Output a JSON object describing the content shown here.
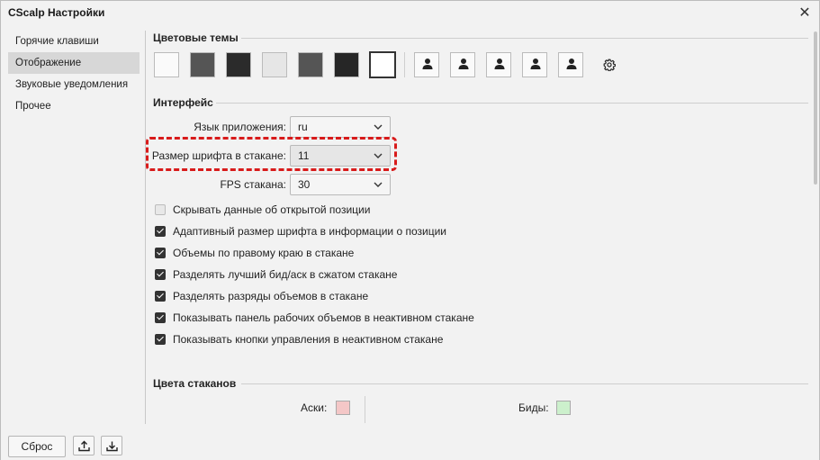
{
  "window": {
    "title": "CScalp Настройки"
  },
  "sidebar": {
    "items": [
      {
        "label": "Горячие клавиши"
      },
      {
        "label": "Отображение"
      },
      {
        "label": "Звуковые уведомления"
      },
      {
        "label": "Прочее"
      }
    ],
    "active_index": 1
  },
  "themes": {
    "title": "Цветовые темы",
    "swatches": [
      "#fafafa",
      "#555555",
      "#2b2b2b",
      "#e6e6e6",
      "#555555",
      "#262626",
      "#ffffff"
    ],
    "selected_index": 6,
    "profile_icons": [
      "person-icon",
      "person-icon",
      "person-icon",
      "person-icon",
      "person-icon"
    ],
    "settings_icon": "gear-icon"
  },
  "interface": {
    "title": "Интерфейс",
    "language": {
      "label": "Язык приложения:",
      "value": "ru"
    },
    "font_size": {
      "label": "Размер шрифта в стакане:",
      "value": "11"
    },
    "fps": {
      "label": "FPS стакана:",
      "value": "30"
    },
    "checkboxes": [
      {
        "label": "Скрывать данные об открытой позиции",
        "checked": false
      },
      {
        "label": "Адаптивный размер шрифта в информации о позиции",
        "checked": true
      },
      {
        "label": "Объемы по правому краю в стакане",
        "checked": true
      },
      {
        "label": "Разделять лучший бид/аск в сжатом стакане",
        "checked": true
      },
      {
        "label": "Разделять разряды объемов в стакане",
        "checked": true
      },
      {
        "label": "Показывать панель рабочих объемов в неактивном стакане",
        "checked": true
      },
      {
        "label": "Показывать кнопки управления в неактивном стакане",
        "checked": true
      }
    ]
  },
  "book_colors": {
    "title": "Цвета стаканов",
    "asks": {
      "label": "Аски:",
      "color": "#f4c7c7"
    },
    "bids": {
      "label": "Биды:",
      "color": "#ccf0cc"
    }
  },
  "footer": {
    "reset_label": "Сброс",
    "export_icon": "upload-icon",
    "import_icon": "download-icon"
  },
  "colors": {
    "highlight_border": "#d81b1b"
  }
}
